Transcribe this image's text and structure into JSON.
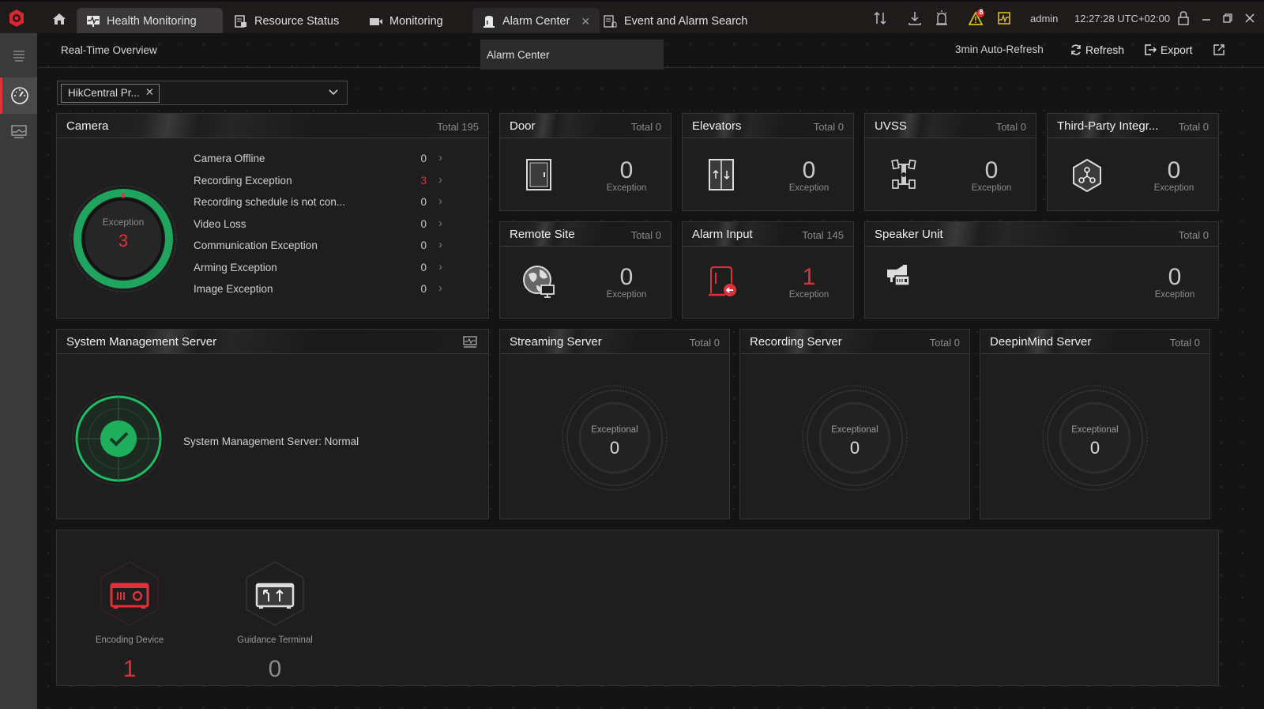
{
  "topbar": {
    "tabs": [
      {
        "label": "Health Monitoring",
        "icon": "monitor-pulse-icon",
        "active": true
      },
      {
        "label": "Resource Status",
        "icon": "resource-status-icon"
      },
      {
        "label": "Monitoring",
        "icon": "camera-icon"
      },
      {
        "label": "Alarm Center",
        "icon": "alarm-light-icon",
        "closable": true
      },
      {
        "label": "Event and Alarm Search",
        "icon": "event-search-icon"
      }
    ],
    "alert_badge": "8",
    "user": "admin",
    "time": "12:27:28 UTC+02:00"
  },
  "subbar": {
    "title": "Real-Time Overview",
    "tooltip": "Alarm Center",
    "auto_refresh": "3min Auto-Refresh",
    "refresh": "Refresh",
    "export": "Export"
  },
  "selector": {
    "chip": "HikCentral Pr..."
  },
  "camera": {
    "title": "Camera",
    "total": "Total 195",
    "ring_label": "Exception",
    "ring_value": "3",
    "items": [
      {
        "label": "Camera Offline",
        "value": "0"
      },
      {
        "label": "Recording Exception",
        "value": "3",
        "alert": true
      },
      {
        "label": "Recording schedule is not con...",
        "value": "0"
      },
      {
        "label": "Video Loss",
        "value": "0"
      },
      {
        "label": "Communication Exception",
        "value": "0"
      },
      {
        "label": "Arming Exception",
        "value": "0"
      },
      {
        "label": "Image Exception",
        "value": "0"
      }
    ]
  },
  "tiles": {
    "door": {
      "title": "Door",
      "total": "Total 0",
      "count": "0",
      "label": "Exception"
    },
    "elevators": {
      "title": "Elevators",
      "total": "Total 0",
      "count": "0",
      "label": "Exception"
    },
    "uvss": {
      "title": "UVSS",
      "total": "Total 0",
      "count": "0",
      "label": "Exception"
    },
    "third_party": {
      "title": "Third-Party Integr...",
      "total": "Total 0",
      "count": "0",
      "label": "Exception"
    },
    "remote_site": {
      "title": "Remote Site",
      "total": "Total 0",
      "count": "0",
      "label": "Exception"
    },
    "alarm_input": {
      "title": "Alarm Input",
      "total": "Total 145",
      "count": "1",
      "label": "Exception"
    },
    "speaker_unit": {
      "title": "Speaker Unit",
      "total": "Total 0",
      "count": "0",
      "label": "Exception"
    }
  },
  "sms": {
    "title": "System Management Server",
    "status": "System Management Server: Normal"
  },
  "servers": {
    "streaming": {
      "title": "Streaming Server",
      "total": "Total 0",
      "label": "Exceptional",
      "count": "0"
    },
    "recording": {
      "title": "Recording Server",
      "total": "Total 0",
      "label": "Exceptional",
      "count": "0"
    },
    "deepinmind": {
      "title": "DeepinMind Server",
      "total": "Total 0",
      "label": "Exceptional",
      "count": "0"
    }
  },
  "devices": [
    {
      "name": "Encoding Device",
      "count": "1",
      "alert": true
    },
    {
      "name": "Guidance Terminal",
      "count": "0"
    }
  ],
  "colors": {
    "alert": "#e0313a",
    "ok": "#1fae5b",
    "warning": "#d4c21a"
  }
}
